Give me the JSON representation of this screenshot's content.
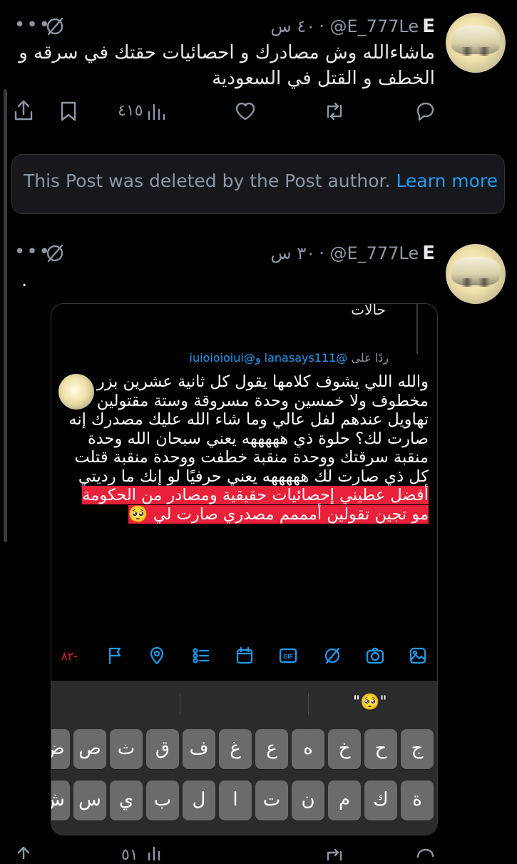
{
  "post1": {
    "name": "E",
    "handle": "@E_777Le",
    "time": "٤٠ س",
    "text": "ماشاءالله وش مصادرك و احصائيات حقتك في سرقه و الخطف و القتل في السعودية",
    "views": "٤١٥",
    "icons": [
      "more-icon",
      "grok-icon",
      "reply-icon",
      "retweet-icon",
      "like-icon",
      "views-icon",
      "bookmark-icon",
      "share-icon"
    ]
  },
  "deleted": {
    "text": "This Post was deleted by the Post author.",
    "link": "Learn more"
  },
  "post2": {
    "name": "E",
    "handle": "@E_777Le",
    "time": "٣٠ س",
    "text": "."
  },
  "card": {
    "top_fragment": "حالات",
    "reply_prefix": "ردًا على",
    "reply_users": "@lanasays111 و@iuioioioiui",
    "body_plain": "والله اللي يشوف كلامها يقول كل ثانية عشرين بزر مخطوف ولا خمسين وحدة مسروقة وستة مقتولين تهاويل عندهم لفل عالي وما شاء الله عليك مصدرك إنه صارت لك؟ حلوة ذي هههههه يعني سبحان الله وحدة منقبة سرقتك ووحدة منقبة خطفت ووحدة منقبة قتلت كل ذي صارت لك هههههه يعني حرفيًا لو إنك ما رديتي",
    "body_highlight": "أفضل عطيني إحصائيات حقيقية ومصادر من الحكومة مو تجين تقولين أمممم مصدري صارت لي 🥺",
    "char_count": "٨٢-",
    "toolbar_icons": [
      "image-icon",
      "camera-icon",
      "grok-icon",
      "gif-icon",
      "poll-icon",
      "list-icon",
      "location-icon",
      "flag-icon"
    ]
  },
  "keyboard": {
    "suggestion": "\"🥺\"",
    "row1": [
      "ج",
      "ح",
      "خ",
      "ه",
      "ع",
      "غ",
      "ف",
      "ق",
      "ث",
      "ص",
      "ض"
    ],
    "row2": [
      "ة",
      "ك",
      "م",
      "ن",
      "ت",
      "ا",
      "ل",
      "ب",
      "ي",
      "س",
      "ش"
    ]
  },
  "bottom_peek": {
    "views": "٥١"
  }
}
